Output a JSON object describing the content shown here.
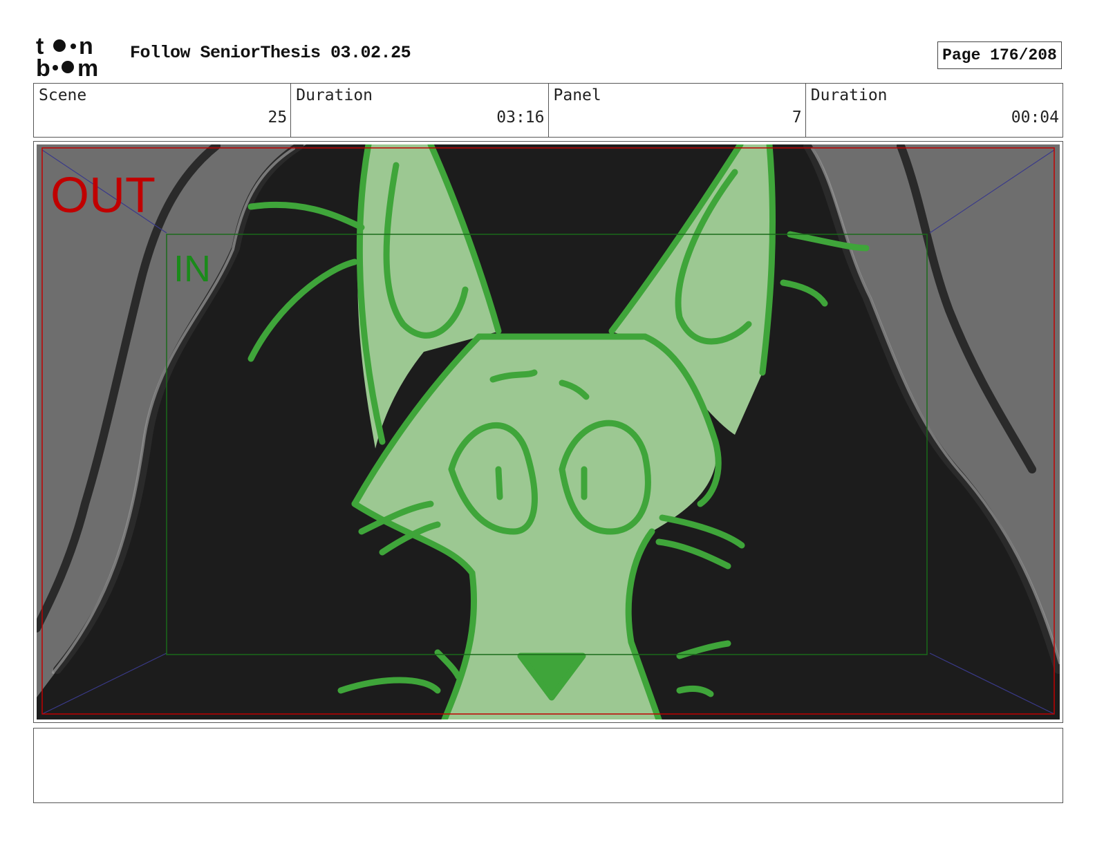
{
  "header": {
    "logo_line1": "t••n",
    "logo_line2": "b••m",
    "title": "Follow SeniorThesis 03.02.25",
    "page": "Page 176/208"
  },
  "info": [
    {
      "label": "Scene",
      "value": "25"
    },
    {
      "label": "Duration",
      "value": "03:16"
    },
    {
      "label": "Panel",
      "value": "7"
    },
    {
      "label": "Duration",
      "value": "00:04"
    }
  ],
  "panel": {
    "out_label": "OUT",
    "in_label": "IN",
    "colors": {
      "out": "#c00000",
      "in": "#1a8a1a",
      "background": "#1c1c1c",
      "wall": "#6e6e6e",
      "character_fill": "#9cc892",
      "character_line": "#3fa53a"
    }
  },
  "caption": {
    "text": ""
  }
}
